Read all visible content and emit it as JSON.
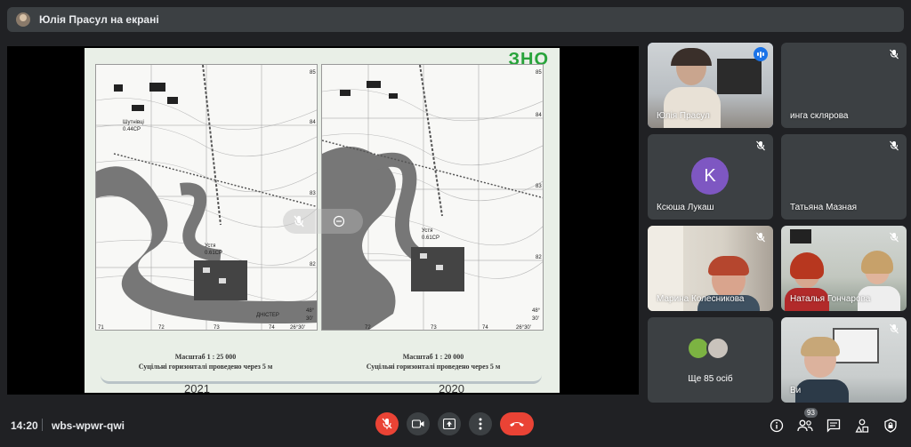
{
  "presenter_bar": {
    "label": "Юлія Прасул на екрані"
  },
  "slide": {
    "logo": "ЗНО",
    "left_map": {
      "scale": "Масштаб 1 : 25 000",
      "contour": "Суцільні горизонталі проведено через 5 м",
      "year": "2021",
      "labels": [
        "Шутнівці",
        "0.44СР",
        "Устя",
        "0.61СР",
        "ДНІСТЕР"
      ],
      "ticks": [
        "71",
        "72",
        "73",
        "74",
        "26°30'",
        "48°",
        "30'",
        "82",
        "83",
        "84",
        "85"
      ]
    },
    "right_map": {
      "scale": "Масштаб 1 : 20 000",
      "contour": "Суцільні горизонталі проведено через 5 м",
      "year": "2020",
      "labels": [
        "Устя",
        "0.61СР"
      ],
      "ticks": [
        "72",
        "73",
        "74",
        "26°30'",
        "48°",
        "30'",
        "82",
        "83",
        "84",
        "85"
      ]
    }
  },
  "tiles": [
    {
      "name": "Юлія Прасул",
      "speaking": true
    },
    {
      "name": "инга склярова",
      "muted": true
    },
    {
      "name": "Ксюша Лукаш",
      "initial": "K",
      "avatar_color": "#7e57c2",
      "muted": true
    },
    {
      "name": "Татьяна Мазная",
      "muted": true
    },
    {
      "name": "Марина Колесникова",
      "muted": true
    },
    {
      "name": "Наталья Гончарова",
      "muted": true
    },
    {
      "name": "Ще 85 осіб"
    },
    {
      "name": "Ви",
      "muted": true
    }
  ],
  "bottom": {
    "time": "14:20",
    "meeting_code": "wbs-wpwr-qwi",
    "participants_count": "93"
  },
  "colors": {
    "background": "#202124",
    "tile": "#3c4043",
    "end_call": "#ea4335",
    "active_outline": "#8ab4f8"
  }
}
